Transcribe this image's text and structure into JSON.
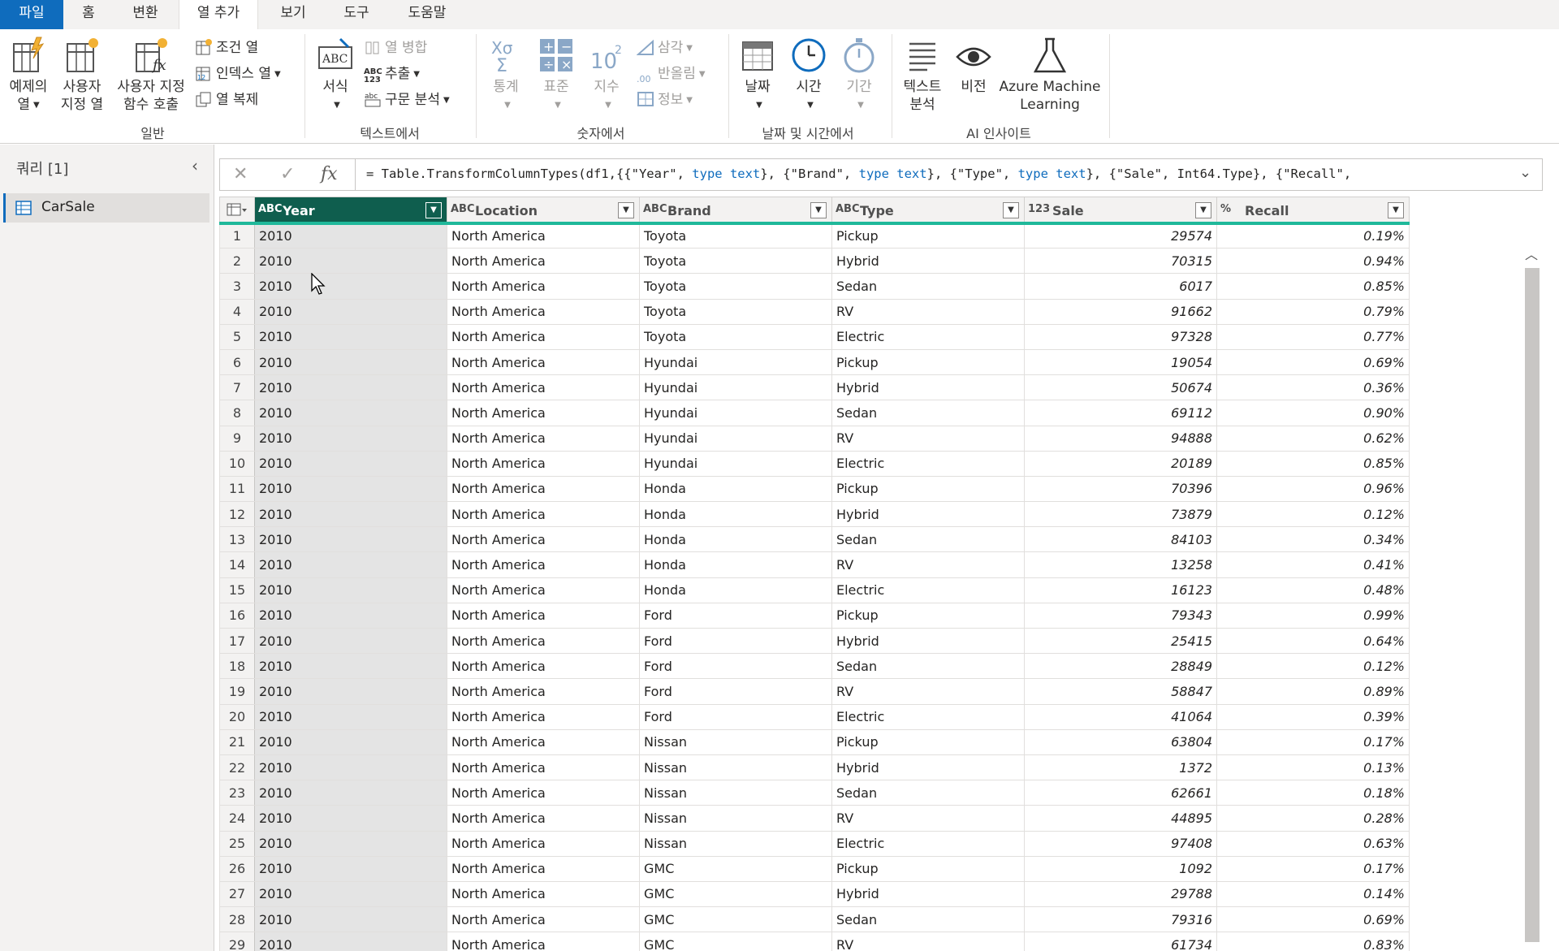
{
  "menu_tabs": [
    "파일",
    "홈",
    "변환",
    "열 추가",
    "보기",
    "도구",
    "도움말"
  ],
  "ribbon": {
    "general": {
      "label": "일반",
      "example_column": [
        "예제의",
        "열"
      ],
      "custom_column": [
        "사용자",
        "지정 열"
      ],
      "invoke_function": [
        "사용자 지정",
        "함수 호출"
      ],
      "conditional_column": "조건 열",
      "index_column": "인덱스 열",
      "duplicate_column": "열 복제"
    },
    "text": {
      "label": "텍스트에서",
      "format": "서식",
      "merge_columns": "열 병합",
      "extract": "추출",
      "parse": "구문 분석"
    },
    "number": {
      "label": "숫자에서",
      "statistics": "통계",
      "standard": "표준",
      "scientific": "지수",
      "trigonometry": "삼각",
      "rounding": "반올림",
      "information": "정보"
    },
    "datetime": {
      "label": "날짜 및 시간에서",
      "date": "날짜",
      "time": "시간",
      "duration": "기간"
    },
    "ai": {
      "label": "AI 인사이트",
      "text_analytics": [
        "텍스트",
        "분석"
      ],
      "vision": "비전",
      "azure_ml": [
        "Azure Machine",
        "Learning"
      ]
    }
  },
  "queries": {
    "title": "쿼리 [1]",
    "items": [
      "CarSale"
    ]
  },
  "formula": {
    "parts": [
      [
        "= Table.TransformColumnTypes(df1,{{\"Year\", ",
        false
      ],
      [
        "type text",
        true
      ],
      [
        "}, {\"Brand\", ",
        false
      ],
      [
        "type text",
        true
      ],
      [
        "}, {\"Type\", ",
        false
      ],
      [
        "type text",
        true
      ],
      [
        "}, {\"Sale\", Int64.Type}, {\"Recall\",",
        false
      ]
    ]
  },
  "table": {
    "columns": [
      {
        "type_icon": "ABC",
        "name": "Year"
      },
      {
        "type_icon": "ABC",
        "name": "Location"
      },
      {
        "type_icon": "ABC",
        "name": "Brand"
      },
      {
        "type_icon": "ABC",
        "name": "Type"
      },
      {
        "type_icon": "123",
        "name": "Sale"
      },
      {
        "type_icon": "%",
        "name": "Recall"
      }
    ],
    "rows": [
      [
        "1",
        "2010",
        "North America",
        "Toyota",
        "Pickup",
        "29574",
        "0.19%"
      ],
      [
        "2",
        "2010",
        "North America",
        "Toyota",
        "Hybrid",
        "70315",
        "0.94%"
      ],
      [
        "3",
        "2010",
        "North America",
        "Toyota",
        "Sedan",
        "6017",
        "0.85%"
      ],
      [
        "4",
        "2010",
        "North America",
        "Toyota",
        "RV",
        "91662",
        "0.79%"
      ],
      [
        "5",
        "2010",
        "North America",
        "Toyota",
        "Electric",
        "97328",
        "0.77%"
      ],
      [
        "6",
        "2010",
        "North America",
        "Hyundai",
        "Pickup",
        "19054",
        "0.69%"
      ],
      [
        "7",
        "2010",
        "North America",
        "Hyundai",
        "Hybrid",
        "50674",
        "0.36%"
      ],
      [
        "8",
        "2010",
        "North America",
        "Hyundai",
        "Sedan",
        "69112",
        "0.90%"
      ],
      [
        "9",
        "2010",
        "North America",
        "Hyundai",
        "RV",
        "94888",
        "0.62%"
      ],
      [
        "10",
        "2010",
        "North America",
        "Hyundai",
        "Electric",
        "20189",
        "0.85%"
      ],
      [
        "11",
        "2010",
        "North America",
        "Honda",
        "Pickup",
        "70396",
        "0.96%"
      ],
      [
        "12",
        "2010",
        "North America",
        "Honda",
        "Hybrid",
        "73879",
        "0.12%"
      ],
      [
        "13",
        "2010",
        "North America",
        "Honda",
        "Sedan",
        "84103",
        "0.34%"
      ],
      [
        "14",
        "2010",
        "North America",
        "Honda",
        "RV",
        "13258",
        "0.41%"
      ],
      [
        "15",
        "2010",
        "North America",
        "Honda",
        "Electric",
        "16123",
        "0.48%"
      ],
      [
        "16",
        "2010",
        "North America",
        "Ford",
        "Pickup",
        "79343",
        "0.99%"
      ],
      [
        "17",
        "2010",
        "North America",
        "Ford",
        "Hybrid",
        "25415",
        "0.64%"
      ],
      [
        "18",
        "2010",
        "North America",
        "Ford",
        "Sedan",
        "28849",
        "0.12%"
      ],
      [
        "19",
        "2010",
        "North America",
        "Ford",
        "RV",
        "58847",
        "0.89%"
      ],
      [
        "20",
        "2010",
        "North America",
        "Ford",
        "Electric",
        "41064",
        "0.39%"
      ],
      [
        "21",
        "2010",
        "North America",
        "Nissan",
        "Pickup",
        "63804",
        "0.17%"
      ],
      [
        "22",
        "2010",
        "North America",
        "Nissan",
        "Hybrid",
        "1372",
        "0.13%"
      ],
      [
        "23",
        "2010",
        "North America",
        "Nissan",
        "Sedan",
        "62661",
        "0.18%"
      ],
      [
        "24",
        "2010",
        "North America",
        "Nissan",
        "RV",
        "44895",
        "0.28%"
      ],
      [
        "25",
        "2010",
        "North America",
        "Nissan",
        "Electric",
        "97408",
        "0.63%"
      ],
      [
        "26",
        "2010",
        "North America",
        "GMC",
        "Pickup",
        "1092",
        "0.17%"
      ],
      [
        "27",
        "2010",
        "North America",
        "GMC",
        "Hybrid",
        "29788",
        "0.14%"
      ],
      [
        "28",
        "2010",
        "North America",
        "GMC",
        "Sedan",
        "79316",
        "0.69%"
      ],
      [
        "29",
        "2010",
        "North America",
        "GMC",
        "RV",
        "61734",
        "0.83%"
      ]
    ]
  },
  "colors": {
    "accent": "#0f6cbd",
    "selected_header": "#0f5e4e",
    "header_rule": "#1fb89a"
  }
}
